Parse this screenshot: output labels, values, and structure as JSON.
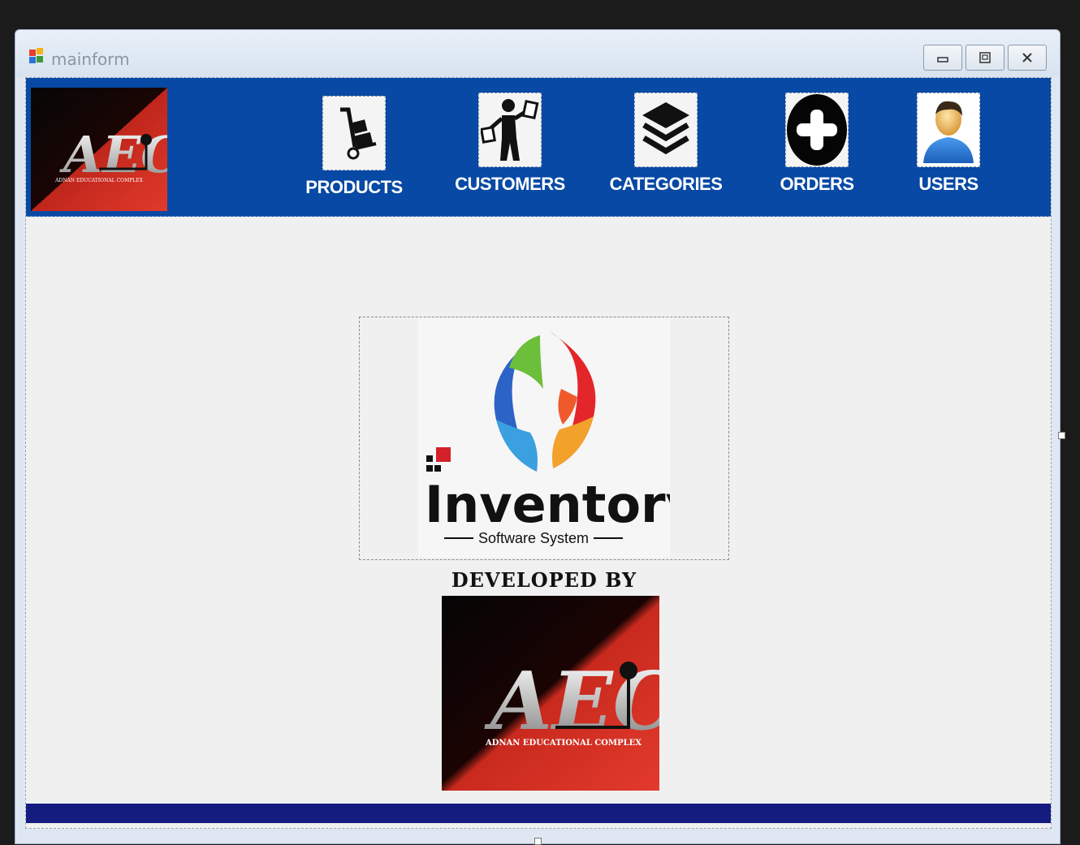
{
  "window": {
    "title": "mainform",
    "controls": {
      "minimize": "minimize",
      "maximize": "maximize",
      "close": "close"
    }
  },
  "nav": {
    "items": [
      {
        "label": "PRODUCTS",
        "icon": "hand-truck-icon"
      },
      {
        "label": "CUSTOMERS",
        "icon": "shopper-icon"
      },
      {
        "label": "CATEGORIES",
        "icon": "layers-icon"
      },
      {
        "label": "ORDERS",
        "icon": "plus-circle-icon"
      },
      {
        "label": "USERS",
        "icon": "user-avatar-icon"
      }
    ]
  },
  "branding": {
    "company_logo_text": "ADNAN EDUCATIONAL COMPLEX",
    "company_monogram": "AEC",
    "product_name": "Inventory",
    "product_tagline": "Software System",
    "developed_by": "DEVELOPED BY"
  },
  "colors": {
    "topbar": "#0749a4",
    "bottombar": "#141c80",
    "client_bg": "#f0f0f0"
  }
}
